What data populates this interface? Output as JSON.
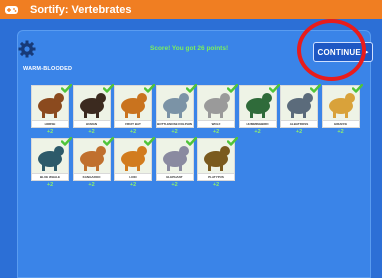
{
  "app": {
    "title": "Sortify: Vertebrates"
  },
  "header": {
    "score_text": "Score! You got 26 points!",
    "continue_label": "CONTINUE"
  },
  "section": {
    "label": "WARM-BLOODED"
  },
  "cards": [
    {
      "label": "HORSE",
      "points": "+2",
      "icon": "horse-icon",
      "color": "#8b4a1e"
    },
    {
      "label": "HUMAN",
      "points": "+2",
      "icon": "human-icon",
      "color": "#3b2a1f"
    },
    {
      "label": "FRUIT BAT",
      "points": "+2",
      "icon": "fruit-bat-icon",
      "color": "#c9731e"
    },
    {
      "label": "BOTTLENOSE DOLPHIN",
      "points": "+2",
      "icon": "dolphin-icon",
      "color": "#7b93a6"
    },
    {
      "label": "WOLF",
      "points": "+2",
      "icon": "wolf-icon",
      "color": "#9a9a9a"
    },
    {
      "label": "HUMMINGBIRD",
      "points": "+2",
      "icon": "hummingbird-icon",
      "color": "#2f6b3a"
    },
    {
      "label": "ALBATROSS",
      "points": "+2",
      "icon": "albatross-icon",
      "color": "#5b6b7b"
    },
    {
      "label": "GIRAFFE",
      "points": "+2",
      "icon": "giraffe-icon",
      "color": "#d9a23a"
    },
    {
      "label": "BLUE WHALE",
      "points": "+2",
      "icon": "blue-whale-icon",
      "color": "#2d5a6a"
    },
    {
      "label": "KANGAROO",
      "points": "+2",
      "icon": "kangaroo-icon",
      "color": "#c0702e"
    },
    {
      "label": "LION",
      "points": "+2",
      "icon": "lion-icon",
      "color": "#d27c1e"
    },
    {
      "label": "ELEPHANT",
      "points": "+2",
      "icon": "elephant-icon",
      "color": "#8a8aa0"
    },
    {
      "label": "PLATYPUS",
      "points": "+2",
      "icon": "platypus-icon",
      "color": "#7a5a1e"
    }
  ]
}
